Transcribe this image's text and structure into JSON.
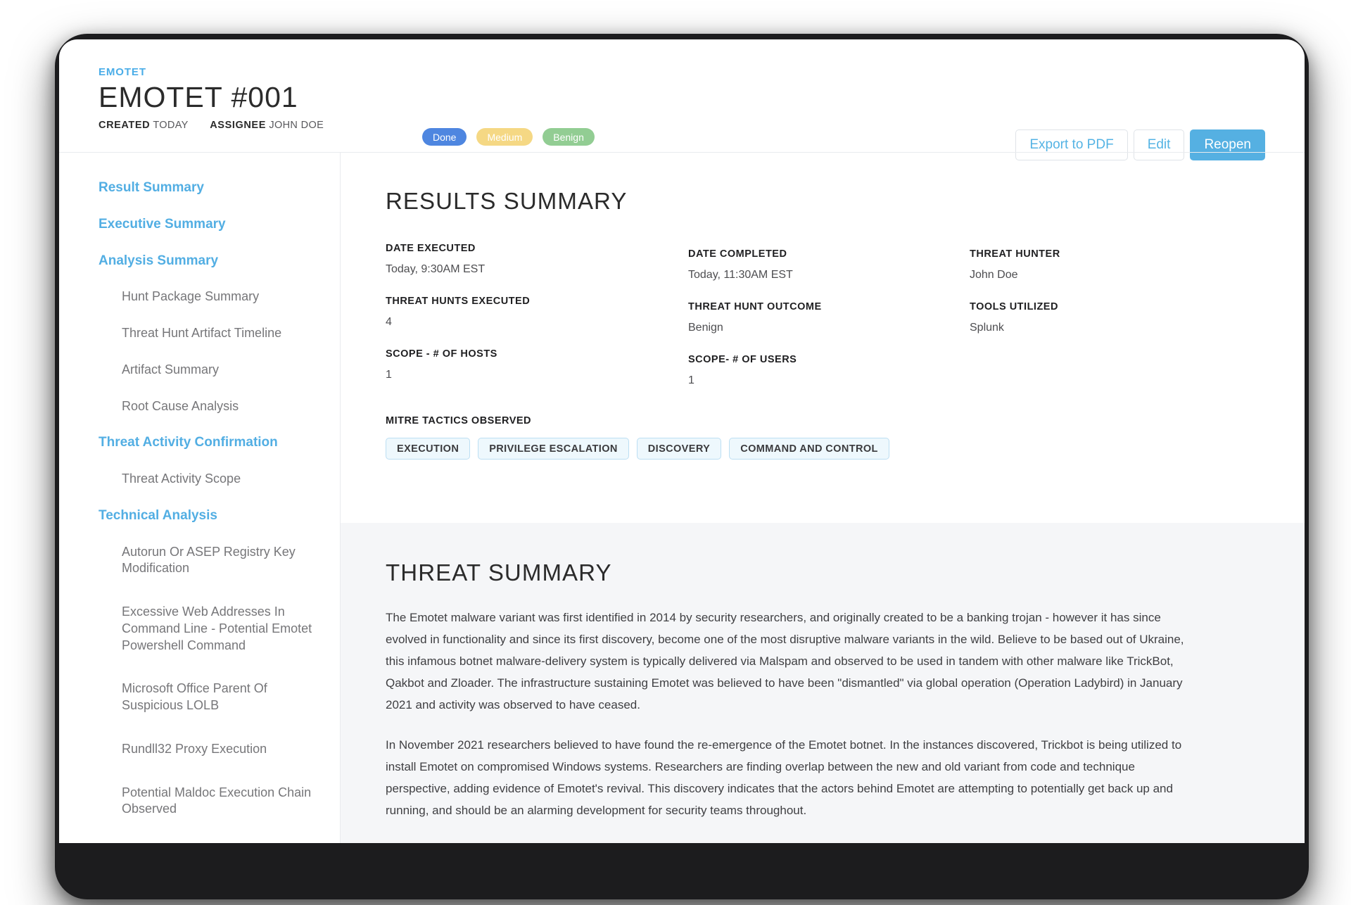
{
  "header": {
    "eyebrow": "EMOTET",
    "title": "EMOTET #001",
    "created_key": "CREATED",
    "created_value": "TODAY",
    "assignee_key": "ASSIGNEE",
    "assignee_value": "JOHN DOE",
    "badges": [
      {
        "label": "Done",
        "color": "#4e86e0"
      },
      {
        "label": "Medium",
        "color": "#f5d884"
      },
      {
        "label": "Benign",
        "color": "#92cd93"
      }
    ],
    "actions": {
      "export": "Export to PDF",
      "edit": "Edit",
      "reopen": "Reopen"
    }
  },
  "sidebar": {
    "items": [
      {
        "label": "Result Summary",
        "level": "head"
      },
      {
        "label": "Executive Summary",
        "level": "head"
      },
      {
        "label": "Analysis Summary",
        "level": "head"
      },
      {
        "label": "Hunt Package Summary",
        "level": "sub"
      },
      {
        "label": "Threat Hunt Artifact Timeline",
        "level": "sub"
      },
      {
        "label": "Artifact Summary",
        "level": "sub"
      },
      {
        "label": "Root Cause Analysis",
        "level": "sub"
      },
      {
        "label": "Threat Activity Confirmation",
        "level": "head"
      },
      {
        "label": "Threat Activity Scope",
        "level": "sub"
      },
      {
        "label": "Technical Analysis",
        "level": "head"
      },
      {
        "label": "Autorun Or ASEP Registry Key Modification",
        "level": "sub-wide"
      },
      {
        "label": "Excessive Web Addresses In Command Line - Potential Emotet Powershell Command",
        "level": "sub-wide"
      },
      {
        "label": "Microsoft Office Parent Of Suspicious LOLB",
        "level": "sub-wide"
      },
      {
        "label": "Rundll32 Proxy Execution",
        "level": "sub-wide"
      },
      {
        "label": "Potential Maldoc Execution Chain Observed",
        "level": "sub-wide"
      }
    ]
  },
  "results": {
    "title": "RESULTS SUMMARY",
    "fields": [
      {
        "label": "DATE EXECUTED",
        "value": "Today, 9:30AM EST"
      },
      {
        "label": "DATE COMPLETED",
        "value": "Today, 11:30AM EST"
      },
      {
        "label": "THREAT HUNTER",
        "value": "John Doe"
      },
      {
        "label": "THREAT HUNTS EXECUTED",
        "value": "4"
      },
      {
        "label": "THREAT HUNT OUTCOME",
        "value": "Benign"
      },
      {
        "label": "TOOLS UTILIZED",
        "value": "Splunk"
      },
      {
        "label": "SCOPE - # OF HOSTS",
        "value": "1"
      },
      {
        "label": "SCOPE- # OF USERS",
        "value": "1"
      },
      {
        "label": "",
        "value": ""
      }
    ],
    "mitre_label": "MITRE TACTICS OBSERVED",
    "mitre_tactics": [
      "EXECUTION",
      "PRIVILEGE ESCALATION",
      "DISCOVERY",
      "COMMAND AND CONTROL"
    ]
  },
  "threat_summary": {
    "title": "THREAT SUMMARY",
    "paragraph_1": "The Emotet malware variant was first identified in 2014 by security researchers, and originally created to be a banking trojan - however it has since evolved in functionality and since its first discovery, become one of the most disruptive malware variants in the wild. Believe to be based out of Ukraine, this infamous botnet malware-delivery system is typically delivered via Malspam and observed to be used in tandem with other malware like TrickBot, Qakbot and Zloader. The infrastructure sustaining Emotet was believed to have been \"dismantled\" via global operation (Operation Ladybird) in January 2021 and activity was observed to have ceased.",
    "paragraph_2": "In November 2021 researchers believed to have found the re-emergence of the Emotet botnet. In the instances discovered, Trickbot is being utilized to install Emotet on compromised Windows systems. Researchers are finding overlap between the new and old variant from code and technique perspective, adding evidence of Emotet's revival. This discovery indicates that the actors behind Emotet are attempting to potentially get back up and running, and should be an alarming development for security teams throughout."
  }
}
